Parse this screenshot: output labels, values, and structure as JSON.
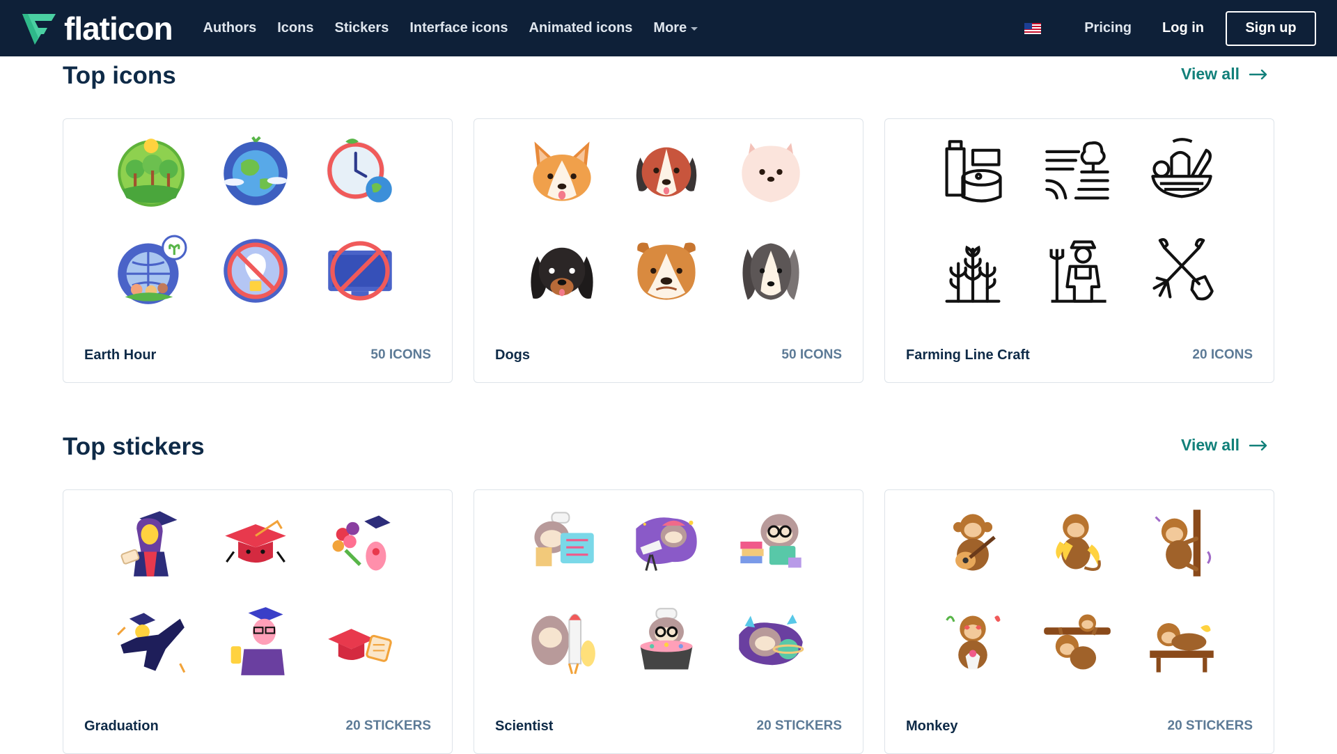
{
  "nav": {
    "logo_text": "flaticon",
    "links": [
      "Authors",
      "Icons",
      "Stickers",
      "Interface icons",
      "Animated icons"
    ],
    "more_label": "More",
    "pricing_label": "Pricing",
    "login_label": "Log in",
    "signup_label": "Sign up",
    "flag_icon": "us-flag-icon"
  },
  "top_icons": {
    "title": "Top icons",
    "view_all_label": "View all",
    "cards": [
      {
        "name": "Earth Hour",
        "count": "50 ICONS",
        "thumbs": [
          "forest-icon",
          "earth-icon",
          "clock-earth-icon",
          "globe-people-plant-icon",
          "no-lightbulb-icon",
          "no-monitor-icon"
        ]
      },
      {
        "name": "Dogs",
        "count": "50 ICONS",
        "thumbs": [
          "corgi-icon",
          "beagle-icon",
          "pomeranian-icon",
          "dachshund-icon",
          "bulldog-icon",
          "husky-icon"
        ]
      },
      {
        "name": "Farming Line Craft",
        "count": "20 ICONS",
        "thumbs": [
          "milk-cheese-icon",
          "field-tree-icon",
          "vegetable-bowl-icon",
          "wheat-icon",
          "farmer-icon",
          "fork-shovel-icon"
        ]
      }
    ]
  },
  "top_stickers": {
    "title": "Top stickers",
    "view_all_label": "View all",
    "cards": [
      {
        "name": "Graduation",
        "count": "20 STICKERS",
        "thumbs": [
          "graduate-woman-sticker",
          "grad-cap-sticker",
          "bouquet-diploma-sticker",
          "jumping-graduate-sticker",
          "graduate-man-sticker",
          "cap-diploma-sticker"
        ]
      },
      {
        "name": "Scientist",
        "count": "20 STICKERS",
        "thumbs": [
          "chef-sloth-sticker",
          "telescope-sloth-sticker",
          "reading-sloth-sticker",
          "rocket-sloth-sticker",
          "cooking-sloth-sticker",
          "planet-sloth-sticker"
        ]
      },
      {
        "name": "Monkey",
        "count": "20 STICKERS",
        "thumbs": [
          "guitar-monkey-sticker",
          "banana-monkey-sticker",
          "climbing-monkey-sticker",
          "love-monkey-sticker",
          "hanging-monkey-sticker",
          "resting-monkey-sticker"
        ]
      }
    ]
  }
}
